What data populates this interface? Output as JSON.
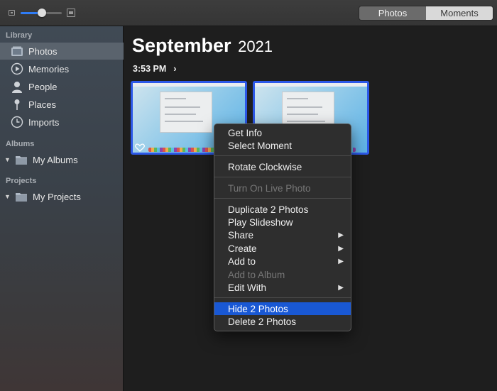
{
  "toolbar": {
    "zoom_level": 0.52,
    "segments": [
      {
        "label": "Photos",
        "active": true
      },
      {
        "label": "Moments",
        "active": false
      }
    ]
  },
  "sidebar": {
    "sections": [
      {
        "header": "Library"
      },
      {
        "header": "Albums"
      },
      {
        "header": "Projects"
      }
    ],
    "library_items": [
      {
        "label": "Photos",
        "icon": "photos-icon",
        "selected": true
      },
      {
        "label": "Memories",
        "icon": "memories-icon",
        "selected": false
      },
      {
        "label": "People",
        "icon": "person-icon",
        "selected": false
      },
      {
        "label": "Places",
        "icon": "pin-icon",
        "selected": false
      },
      {
        "label": "Imports",
        "icon": "clock-icon",
        "selected": false
      }
    ],
    "albums_item": {
      "label": "My Albums",
      "icon": "folder-icon"
    },
    "projects_item": {
      "label": "My Projects",
      "icon": "folder-icon"
    }
  },
  "main": {
    "title_month": "September",
    "title_year": "2021",
    "time": "3:53 PM",
    "time_chevron": "›"
  },
  "context_menu": {
    "items": [
      {
        "label": "Get Info",
        "enabled": true
      },
      {
        "label": "Select Moment",
        "enabled": true
      },
      {
        "label": "Rotate Clockwise",
        "enabled": true
      },
      {
        "label": "Turn On Live Photo",
        "enabled": false
      },
      {
        "label": "Duplicate 2 Photos",
        "enabled": true
      },
      {
        "label": "Play Slideshow",
        "enabled": true
      },
      {
        "label": "Share",
        "enabled": true,
        "submenu": true
      },
      {
        "label": "Create",
        "enabled": true,
        "submenu": true
      },
      {
        "label": "Add to",
        "enabled": true,
        "submenu": true
      },
      {
        "label": "Add to Album",
        "enabled": false
      },
      {
        "label": "Edit With",
        "enabled": true,
        "submenu": true
      },
      {
        "label": "Hide 2 Photos",
        "enabled": true,
        "highlighted": true
      },
      {
        "label": "Delete 2 Photos",
        "enabled": true
      }
    ],
    "submenu_arrow": "▶"
  },
  "colors": {
    "accent": "#2c58e8",
    "highlight": "#1958d4",
    "sidebar_selected": "#5a636d"
  }
}
